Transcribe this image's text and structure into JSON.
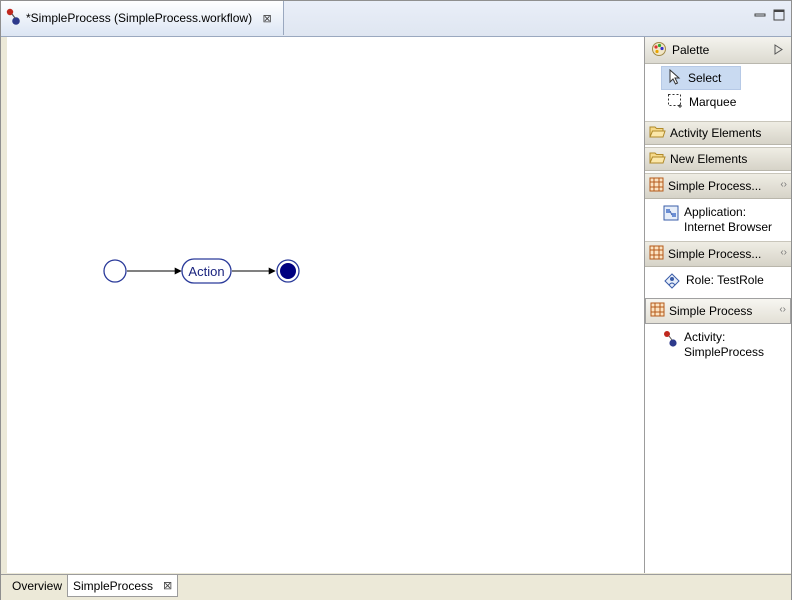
{
  "editor": {
    "tab_title": "*SimpleProcess (SimpleProcess.workflow)",
    "close_glyph": "⊠"
  },
  "window_controls": {
    "minimize": "minimize-icon",
    "maximize": "maximize-icon"
  },
  "diagram": {
    "action_label": "Action",
    "nodes": [
      "start-node",
      "action-node",
      "end-node"
    ]
  },
  "palette": {
    "title": "Palette",
    "tools": [
      {
        "label": "Select",
        "icon": "arrow-pointer-icon",
        "selected": true
      },
      {
        "label": "Marquee",
        "icon": "marquee-icon",
        "selected": false
      }
    ],
    "drawers": [
      {
        "label": "Activity Elements",
        "icon": "folder-icon"
      },
      {
        "label": "New Elements",
        "icon": "folder-icon"
      }
    ],
    "groups": [
      {
        "label": "Simple Process...",
        "entry_line1": "Application:",
        "entry_line2": "Internet Browser",
        "entry_icon": "application-icon"
      },
      {
        "label": "Simple Process...",
        "entry_line1": "Role: TestRole",
        "entry_icon": "role-icon"
      },
      {
        "label": "Simple Process",
        "entry_line1": "Activity:",
        "entry_line2": "SimpleProcess",
        "entry_icon": "activity-icon"
      }
    ]
  },
  "bottom_tabs": {
    "overview": "Overview",
    "simpleprocess": "SimpleProcess",
    "close_glyph": "⊠"
  },
  "colors": {
    "node_blue": "#000080",
    "selection_blue": "#c9daf1"
  }
}
